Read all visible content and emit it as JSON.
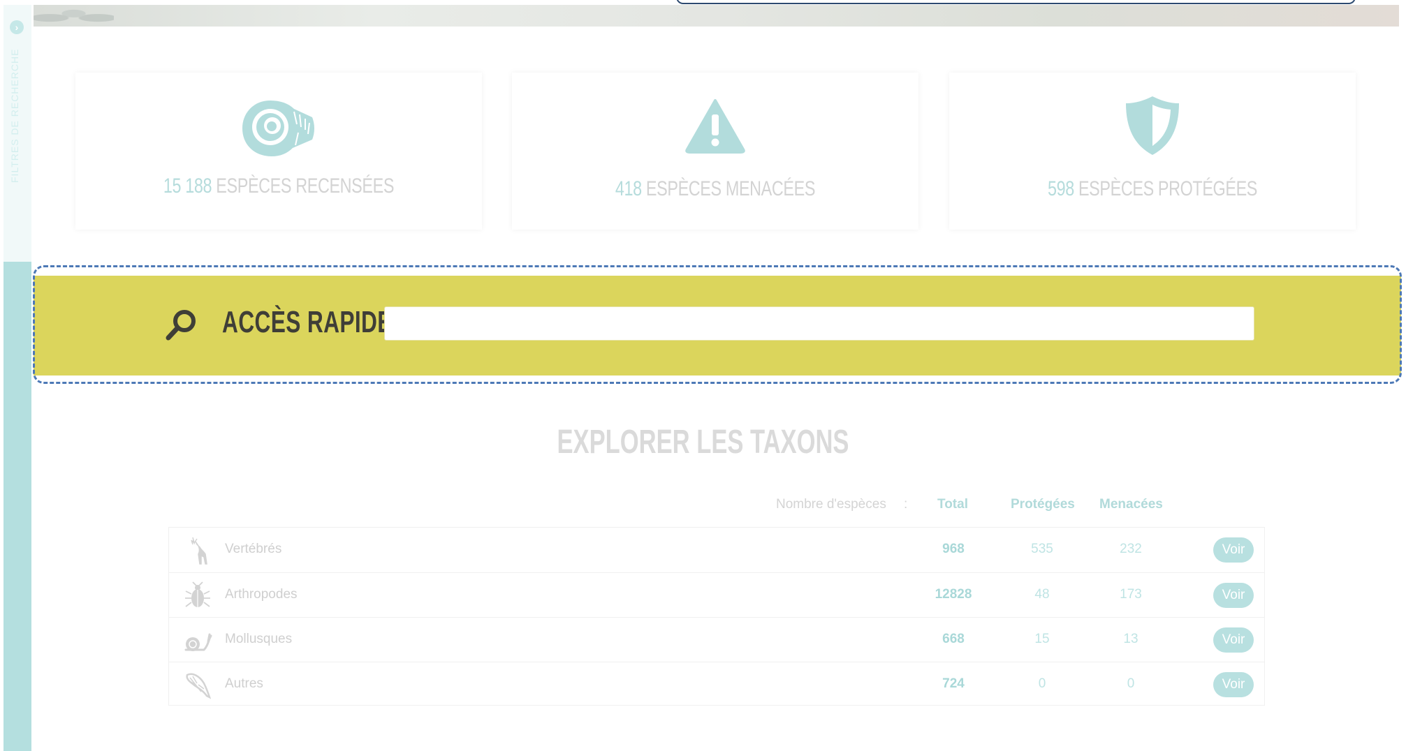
{
  "sidebar": {
    "label": "FILTRES DE RECHERCHE",
    "toggle_icon": "chevron-right-icon"
  },
  "stats": [
    {
      "number": "15 188",
      "label": "ESPÈCES RECENSÉES",
      "icon": "ammonite-icon"
    },
    {
      "number": "418",
      "label": "ESPÈCES MENACÉES",
      "icon": "warning-icon"
    },
    {
      "number": "598",
      "label": "ESPÈCES PROTÉGÉES",
      "icon": "shield-icon"
    }
  ],
  "quick_access": {
    "label": "ACCÈS RAPIDE",
    "icon": "search-icon",
    "value": "",
    "placeholder": ""
  },
  "explore": {
    "title": "EXPLORER LES TAXONS",
    "header_label": "Nombre d'espèces",
    "header_separator": ":",
    "columns": {
      "total": "Total",
      "protected": "Protégées",
      "threatened": "Menacées"
    },
    "rows": [
      {
        "name": "Vertébrés",
        "total": "968",
        "protected": "535",
        "threatened": "232",
        "button": "Voir",
        "icon": "deer-icon"
      },
      {
        "name": "Arthropodes",
        "total": "12828",
        "protected": "48",
        "threatened": "173",
        "button": "Voir",
        "icon": "beetle-icon"
      },
      {
        "name": "Mollusques",
        "total": "668",
        "protected": "15",
        "threatened": "13",
        "button": "Voir",
        "icon": "snail-icon"
      },
      {
        "name": "Autres",
        "total": "724",
        "protected": "0",
        "threatened": "0",
        "button": "Voir",
        "icon": "trilobite-icon"
      }
    ]
  },
  "colors": {
    "accent_teal": "#b6dcdc",
    "quick_access_bg": "#dbd55c",
    "sidebar_teal": "#b4dfdf"
  }
}
